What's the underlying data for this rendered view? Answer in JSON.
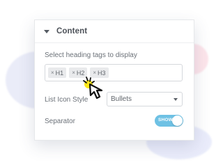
{
  "panel": {
    "title": "Content",
    "heading_tags_label": "Select heading tags to display",
    "tags": [
      {
        "remove": "×",
        "label": "H1"
      },
      {
        "remove": "×",
        "label": "H2"
      },
      {
        "remove": "×",
        "label": "H3"
      }
    ],
    "list_icon_style_label": "List Icon Style",
    "list_icon_style_value": "Bullets",
    "separator_label": "Separator",
    "separator_toggle_text": "SHOW",
    "separator_enabled": true
  },
  "colors": {
    "accent": "#6ec1e4",
    "cursor_highlight": "#ffe600",
    "cursor": "#111111"
  },
  "icons": {
    "collapse": "caret-down-icon",
    "select": "chevron-down-icon",
    "pointer": "mouse-pointer-icon"
  }
}
